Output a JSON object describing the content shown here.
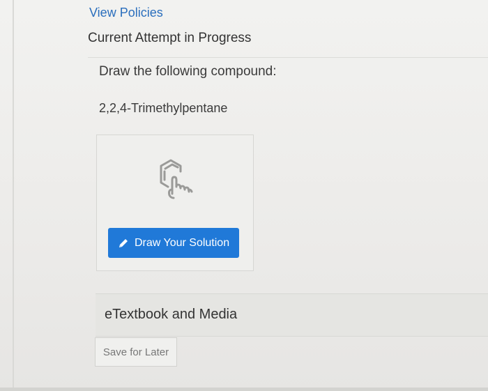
{
  "header": {
    "view_policies": "View Policies",
    "attempt_title": "Current Attempt in Progress"
  },
  "question": {
    "prompt": "Draw the following compound:",
    "compound": "2,2,4-Trimethylpentane"
  },
  "drawing": {
    "icon": "chemical-sketch-icon",
    "button_icon": "pencil-icon",
    "button_label": "Draw Your Solution",
    "button_color": "#2079d8"
  },
  "resources": {
    "label": "eTextbook and Media"
  },
  "actions": {
    "save_label": "Save for Later"
  },
  "colors": {
    "link": "#2a6ebd",
    "background": "#eeeeec"
  }
}
